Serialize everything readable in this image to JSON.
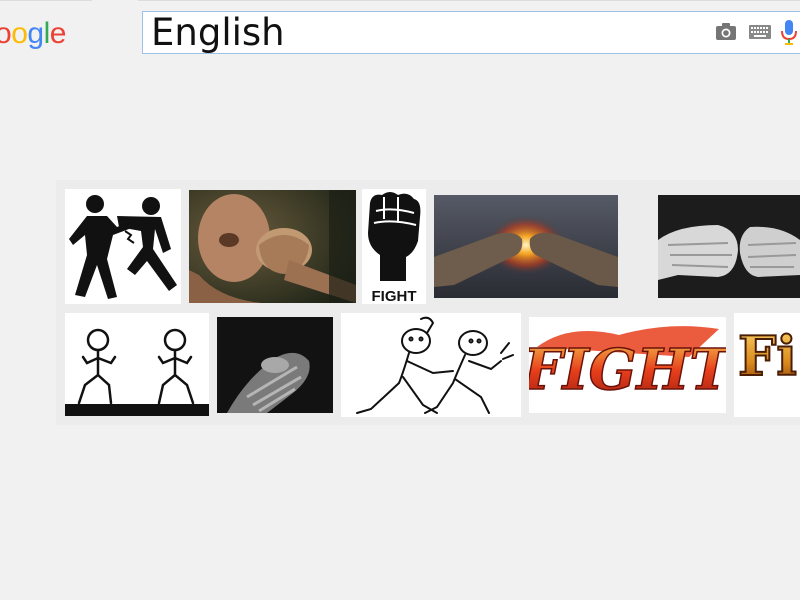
{
  "logo": {
    "letters": [
      {
        "ch": "o",
        "color": "#ea4335"
      },
      {
        "ch": "o",
        "color": "#fbbc05"
      },
      {
        "ch": "g",
        "color": "#4285f4"
      },
      {
        "ch": "l",
        "color": "#34a853"
      },
      {
        "ch": "e",
        "color": "#ea4335"
      }
    ]
  },
  "search": {
    "value": "English",
    "icons": [
      "camera-icon",
      "keyboard-icon",
      "microphone-icon"
    ]
  },
  "results": {
    "row1": [
      {
        "name": "stick-figures-punch",
        "caption": ""
      },
      {
        "name": "man-punched-face",
        "caption": ""
      },
      {
        "name": "raised-fist-fight",
        "caption": "FIGHT"
      },
      {
        "name": "fists-colliding-fire",
        "caption": ""
      },
      {
        "name": "wrapped-fists-bw",
        "caption": ""
      }
    ],
    "row2": [
      {
        "name": "cartoon-boxers",
        "caption": ""
      },
      {
        "name": "wrapped-hands-dark",
        "caption": ""
      },
      {
        "name": "cartoon-fight-sketch",
        "caption": ""
      },
      {
        "name": "fight-fire-logo",
        "caption": "FIGHT"
      },
      {
        "name": "fight-gold-logo",
        "caption": "Fi"
      }
    ]
  },
  "colors": {
    "search_border": "#9fc1e8",
    "background": "#f1f1f1",
    "fire_red": "#e8401c",
    "fire_orange": "#f5a623"
  }
}
